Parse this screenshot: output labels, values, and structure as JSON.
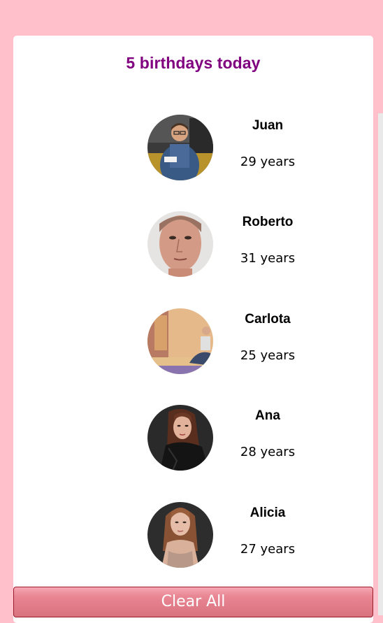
{
  "header": {
    "title": "5 birthdays today"
  },
  "people": [
    {
      "name": "Juan",
      "age": "29 years"
    },
    {
      "name": "Roberto",
      "age": "31 years"
    },
    {
      "name": "Carlota",
      "age": "25 years"
    },
    {
      "name": "Ana",
      "age": "28 years"
    },
    {
      "name": "Alicia",
      "age": "27 years"
    }
  ],
  "actions": {
    "clear_label": "Clear All"
  },
  "colors": {
    "page_background": "#ffc0cb",
    "title": "#800080",
    "button": "#e27d8a"
  }
}
